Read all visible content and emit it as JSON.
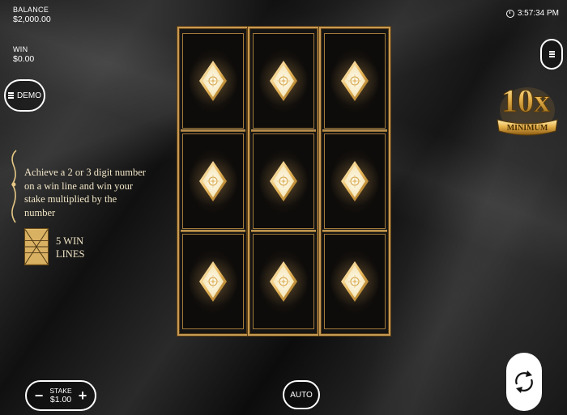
{
  "balance": {
    "label": "BALANCE",
    "value": "$2,000.00"
  },
  "win": {
    "label": "WIN",
    "value": "$0.00"
  },
  "clock": {
    "time": "3:57:34 PM"
  },
  "demo_button": {
    "label": "DEMO"
  },
  "badge": {
    "amount": "10x",
    "text": "MINIMUM"
  },
  "description": {
    "text": "Achieve a 2 or 3 digit number on a win line and win your stake multiplied by the number"
  },
  "win_lines": {
    "text": "5 WIN LINES"
  },
  "stake": {
    "label": "STAKE",
    "value": "$1.00",
    "minus": "−",
    "plus": "+"
  },
  "auto_button": {
    "label": "AUTO"
  },
  "reels": {
    "columns": 3,
    "rows": 3,
    "symbol": "diamond-emblem"
  },
  "colors": {
    "gold": "#c89a52",
    "background": "#1a1a1a",
    "text_cream": "#f3e7c8"
  }
}
